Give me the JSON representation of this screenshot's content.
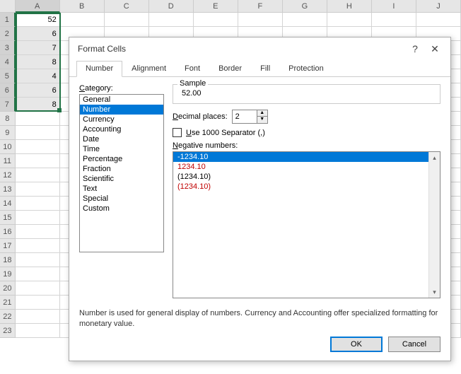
{
  "sheet": {
    "columns": [
      "A",
      "B",
      "C",
      "D",
      "E",
      "F",
      "G",
      "H",
      "I",
      "J"
    ],
    "rows": 23,
    "selected_col_index": 0,
    "selected_rows": [
      1,
      2,
      3,
      4,
      5,
      6,
      7
    ],
    "cells": {
      "A1": "52",
      "A2": "6",
      "A3": "7",
      "A4": "8",
      "A5": "4",
      "A6": "6",
      "A7": "8"
    }
  },
  "dialog": {
    "title": "Format Cells",
    "help_symbol": "?",
    "close_symbol": "✕",
    "tabs": [
      "Number",
      "Alignment",
      "Font",
      "Border",
      "Fill",
      "Protection"
    ],
    "active_tab": "Number",
    "category_label": "Category:",
    "categories": [
      "General",
      "Number",
      "Currency",
      "Accounting",
      "Date",
      "Time",
      "Percentage",
      "Fraction",
      "Scientific",
      "Text",
      "Special",
      "Custom"
    ],
    "selected_category": "Number",
    "sample_label": "Sample",
    "sample_value": "52.00",
    "decimal_label": "Decimal places:",
    "decimal_value": "2",
    "separator_label": "Use 1000 Separator (,)",
    "negative_label": "Negative numbers:",
    "negative_items": [
      {
        "text": "-1234.10",
        "color": "black",
        "selected": true
      },
      {
        "text": "1234.10",
        "color": "red",
        "selected": false
      },
      {
        "text": "(1234.10)",
        "color": "black",
        "selected": false
      },
      {
        "text": "(1234.10)",
        "color": "red",
        "selected": false
      }
    ],
    "description": "Number is used for general display of numbers.  Currency and Accounting offer specialized formatting for monetary value.",
    "ok_label": "OK",
    "cancel_label": "Cancel",
    "spin_up": "▲",
    "spin_down": "▼"
  }
}
